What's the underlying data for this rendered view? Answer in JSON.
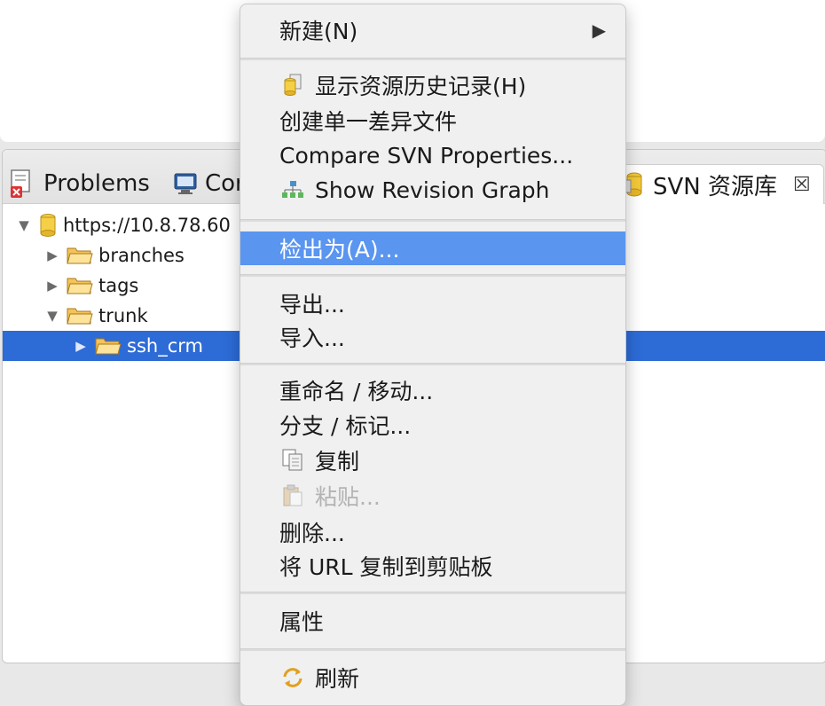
{
  "views": {
    "tabs": [
      {
        "label": "Problems",
        "icon": "problems-icon"
      },
      {
        "label": "Cor",
        "icon": "console-icon"
      },
      {
        "label": "SVN 资源库",
        "icon": "svn-repo-icon",
        "close": "☒"
      }
    ]
  },
  "tree": {
    "items": [
      {
        "label": "https://10.8.78.60",
        "icon": "repository-icon",
        "expanded": true
      },
      {
        "label": "branches",
        "icon": "folder-icon",
        "expanded": false
      },
      {
        "label": "tags",
        "icon": "folder-icon",
        "expanded": false
      },
      {
        "label": "trunk",
        "icon": "folder-icon",
        "expanded": true
      },
      {
        "label": "ssh_crm",
        "icon": "folder-icon",
        "expanded": false,
        "selected": true
      }
    ]
  },
  "context_menu": {
    "new": "新建(N)",
    "new_arrow": "▶",
    "show_history": "显示资源历史记录(H)",
    "create_patch": "创建单一差异文件",
    "compare_props": "Compare SVN Properties...",
    "revision_graph": "Show Revision Graph",
    "checkout_as": "检出为(A)...",
    "export": "导出...",
    "import": "导入...",
    "rename_move": "重命名 / 移动...",
    "branch_tag": "分支 / 标记...",
    "copy": "复制",
    "paste": "粘贴...",
    "delete": "删除...",
    "copy_url": "将 URL 复制到剪贴板",
    "properties": "属性",
    "refresh": "刷新"
  },
  "colors": {
    "selection": "#2d6bd6",
    "menu_highlight": "#5a95f0"
  }
}
